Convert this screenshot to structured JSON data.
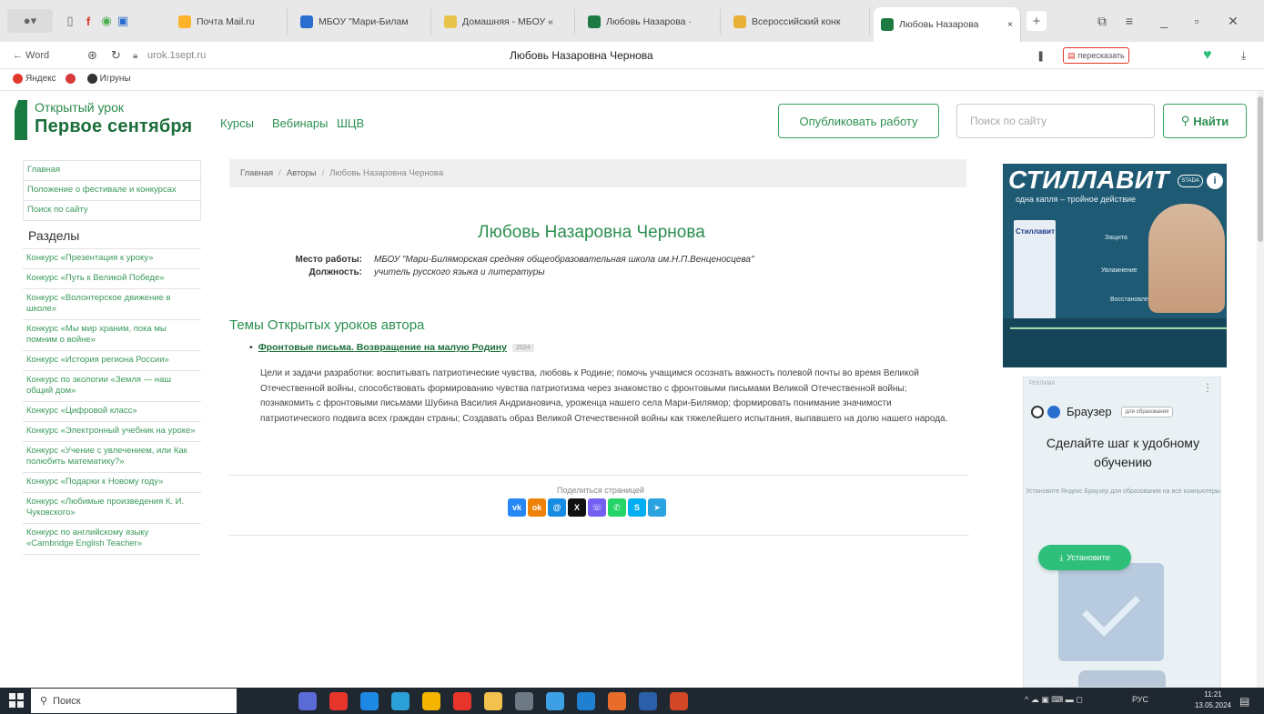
{
  "browser": {
    "tabs": [
      {
        "label": "Почта Mail.ru",
        "color": "#ffb22b"
      },
      {
        "label": "МБОУ \"Мари-Билам",
        "color": "#2a6ed0"
      },
      {
        "label": "Домашняя - МБОУ «",
        "color": "#e8c34c"
      },
      {
        "label": "Любовь Назарова ·",
        "color": "#1c7a42"
      },
      {
        "label": "Всероссийский конк",
        "color": "#e8b037"
      },
      {
        "label": "Любовь Назарова",
        "color": "#1c7a42"
      }
    ],
    "active_tab_index": 5,
    "back_label": "← Word",
    "url": "urok.1sept.ru",
    "page_title": "Любовь Назаровна Чернова",
    "retell_label": "пересказать",
    "bookmarks": [
      {
        "label": "Яндекс",
        "color": "#e0382b"
      },
      {
        "label": "",
        "color": "#d63a3a"
      },
      {
        "label": "Игруны",
        "color": "#333333"
      }
    ]
  },
  "site": {
    "logo_small": "Открытый урок",
    "logo_big": "Первое сентября",
    "nav": [
      "Курсы",
      "Вебинары",
      "ШЦВ"
    ],
    "publish_label": "Опубликовать работу",
    "search_placeholder": "Поиск по сайту",
    "search_button": "Найти"
  },
  "sidebar": {
    "top_links": [
      "Главная",
      "Положение о фестивале и конкурсах",
      "Поиск по сайту"
    ],
    "section_title": "Разделы",
    "items": [
      "Конкурс «Презентация к уроку»",
      "Конкурс «Путь к Великой Победе»",
      "Конкурс «Волонтерское движение в школе»",
      "Конкурс «Мы мир храним, пока мы помним о войне»",
      "Конкурс «История региона России»",
      "Конкурс по экологии «Земля — наш общий дом»",
      "Конкурс «Цифровой класс»",
      "Конкурс «Электронный учебник на уроке»",
      "Конкурс «Учение с увлечением, или Как полюбить математику?»",
      "Конкурс «Подарки к Новому году»",
      "Конкурс «Любимые произведения К. И. Чуковского»",
      "Конкурс по английскому языку «Cambridge English Teacher»"
    ]
  },
  "breadcrumb": [
    "Главная",
    "Авторы",
    "Любовь Назаровна Чернова"
  ],
  "author": {
    "name": "Любовь Назаровна Чернова",
    "workplace_label": "Место работы:",
    "workplace": "МБОУ \"Мари-Биляморская средняя общеобразовательная школа им.Н.П.Венценосцева\"",
    "position_label": "Должность:",
    "position": "учитель русского языка и литературы"
  },
  "topics": {
    "title": "Темы Открытых уроков автора",
    "lessons": [
      {
        "title": "Фронтовые письма. Возвращение на малую Родину",
        "badge": "2024",
        "description": "Цели и задачи разработки: воспитывать патриотические чувства, любовь к Родине; помочь учащимся осознать важность полевой почты во время Великой Отечественной войны, способствовать формированию чувства патриотизма через знакомство с фронтовыми письмами Великой Отечественной войны; познакомить с фронтовыми письмами Шубина Василия Андриановича, уроженца нашего села Мари-Билямор; формировать понимание значимости патриотического подвига всех граждан страны; Создавать образ Великой Отечественной войны как тяжелейшего испытания, выпавшего на долю нашего народа."
      }
    ]
  },
  "share": {
    "label": "Поделиться страницей",
    "buttons": [
      {
        "name": "vk",
        "glyph": "vk",
        "color": "#2787f5"
      },
      {
        "name": "ok",
        "glyph": "ok",
        "color": "#ee8208"
      },
      {
        "name": "mailru",
        "glyph": "@",
        "color": "#168de2"
      },
      {
        "name": "x",
        "glyph": "X",
        "color": "#111111"
      },
      {
        "name": "viber",
        "glyph": "☏",
        "color": "#7360f2"
      },
      {
        "name": "whatsapp",
        "glyph": "✆",
        "color": "#25d366"
      },
      {
        "name": "skype",
        "glyph": "S",
        "color": "#00aff0"
      },
      {
        "name": "telegram",
        "glyph": "➤",
        "color": "#2aa3e0"
      }
    ]
  },
  "ads": {
    "stillavit": {
      "title": "СТИЛЛАВИТ",
      "subtitle": "одна капля – тройное действие",
      "box_label": "Стиллавит",
      "tags": [
        "Защита",
        "Увлажнение",
        "Восстановление"
      ],
      "badge": "STADA"
    },
    "yandex": {
      "label": "РЕКЛАМА",
      "brand": "Браузер",
      "pill": "для образования",
      "headline": "Сделайте шаг к удобному обучению",
      "body": "Установите Яндекс Браузер для образования на все компьютеры",
      "install": "Установите"
    }
  },
  "taskbar": {
    "search_placeholder": "Поиск",
    "lang": "РУС",
    "time": "11:21",
    "date": "13.05.2024",
    "apps": [
      {
        "name": "cortana",
        "color": "#5b6bd6"
      },
      {
        "name": "yandex-browser",
        "color": "#e8352b"
      },
      {
        "name": "mail",
        "color": "#1e88e5"
      },
      {
        "name": "edge",
        "color": "#2a9fd8"
      },
      {
        "name": "chrome",
        "color": "#f4b400"
      },
      {
        "name": "yandex",
        "color": "#e8352b"
      },
      {
        "name": "explorer",
        "color": "#f2c14e"
      },
      {
        "name": "calculator",
        "color": "#6d7a86"
      },
      {
        "name": "ie",
        "color": "#3ea0e4"
      },
      {
        "name": "store",
        "color": "#1f7fd1"
      },
      {
        "name": "paint",
        "color": "#e86d2b"
      },
      {
        "name": "word",
        "color": "#2b5faa"
      },
      {
        "name": "powerpoint",
        "color": "#d24726"
      }
    ]
  }
}
